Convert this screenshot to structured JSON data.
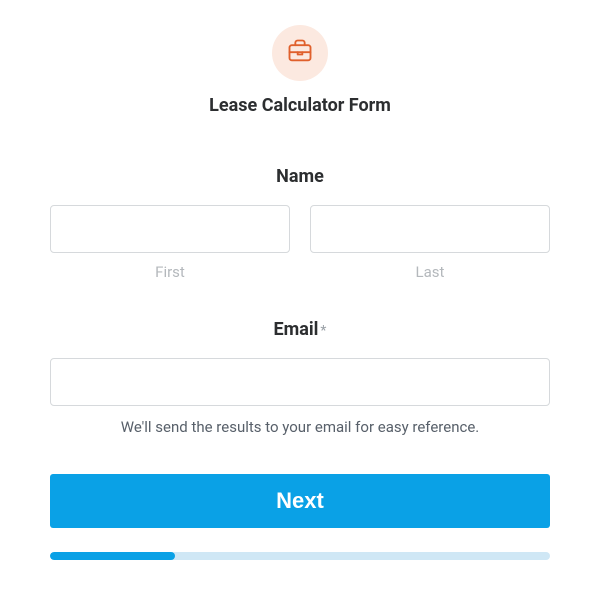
{
  "header": {
    "icon": "briefcase-icon",
    "title": "Lease Calculator Form"
  },
  "name": {
    "label": "Name",
    "first_sub": "First",
    "last_sub": "Last",
    "first_value": "",
    "last_value": ""
  },
  "email": {
    "label": "Email",
    "required_mark": "*",
    "value": "",
    "helper": "We'll send the results to your email for easy reference."
  },
  "actions": {
    "next_label": "Next"
  },
  "progress": {
    "percent": 25
  },
  "colors": {
    "accent": "#0aa1e6",
    "iconbg": "#fce9e0",
    "iconstroke": "#e0602c"
  }
}
